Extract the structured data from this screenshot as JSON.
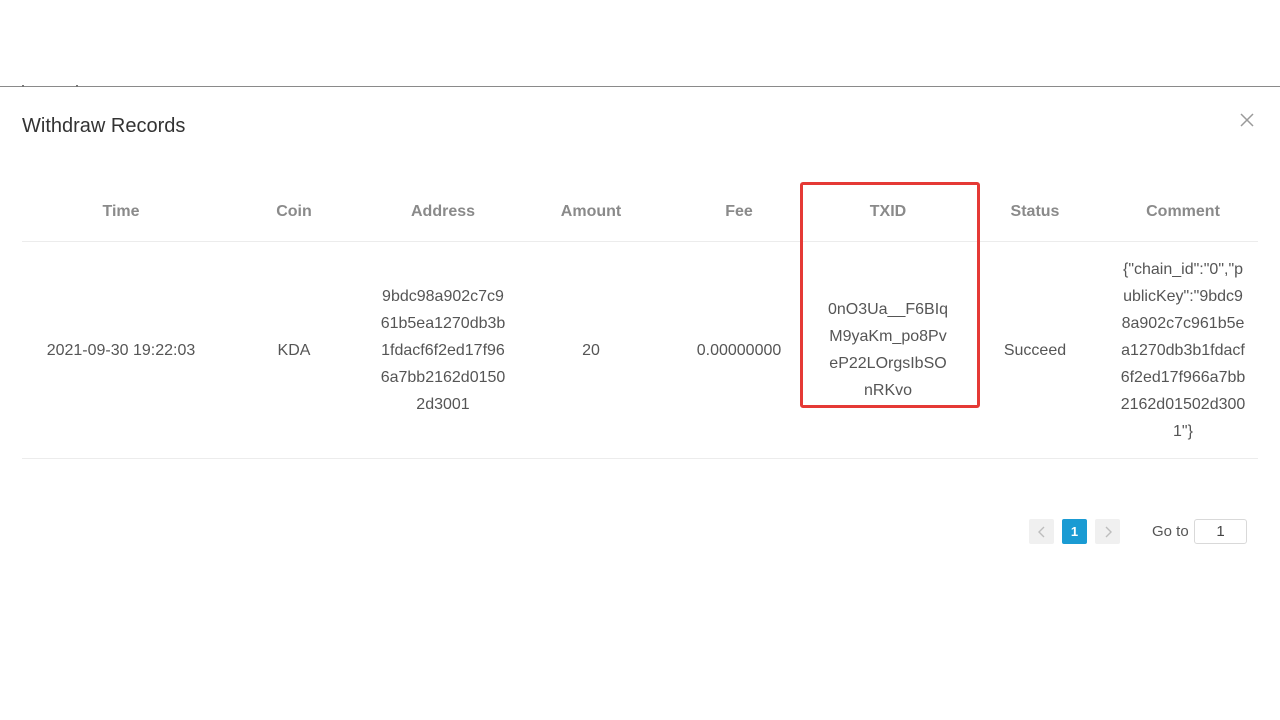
{
  "modal": {
    "title": "Withdraw Records",
    "close_icon": "close-icon"
  },
  "table": {
    "headers": [
      "Time",
      "Coin",
      "Address",
      "Amount",
      "Fee",
      "TXID",
      "Status",
      "Comment"
    ],
    "rows": [
      {
        "time": "2021-09-30 19:22:03",
        "coin": "KDA",
        "address": "9bdc98a902c7c961b5ea1270db3b1fdacf6f2ed17f966a7bb2162d01502d3001",
        "amount": "20",
        "fee": "0.00000000",
        "txid": "0nO3Ua__F6BIqM9yaKm_po8PveP22LOrgsIbSOnRKvo",
        "status": "Succeed",
        "comment": "{\"chain_id\":\"0\",\"publicKey\":\"9bdc98a902c7c961b5ea1270db3b1fdacf6f2ed17f966a7bb2162d01502d3001\"}"
      }
    ]
  },
  "pagination": {
    "prev_icon": "chevron-left-icon",
    "current_page": "1",
    "next_icon": "chevron-right-icon",
    "goto_label": "Go to",
    "goto_value": "1",
    "accent_color": "#1a9bd3"
  },
  "highlight_color": "#e53935"
}
